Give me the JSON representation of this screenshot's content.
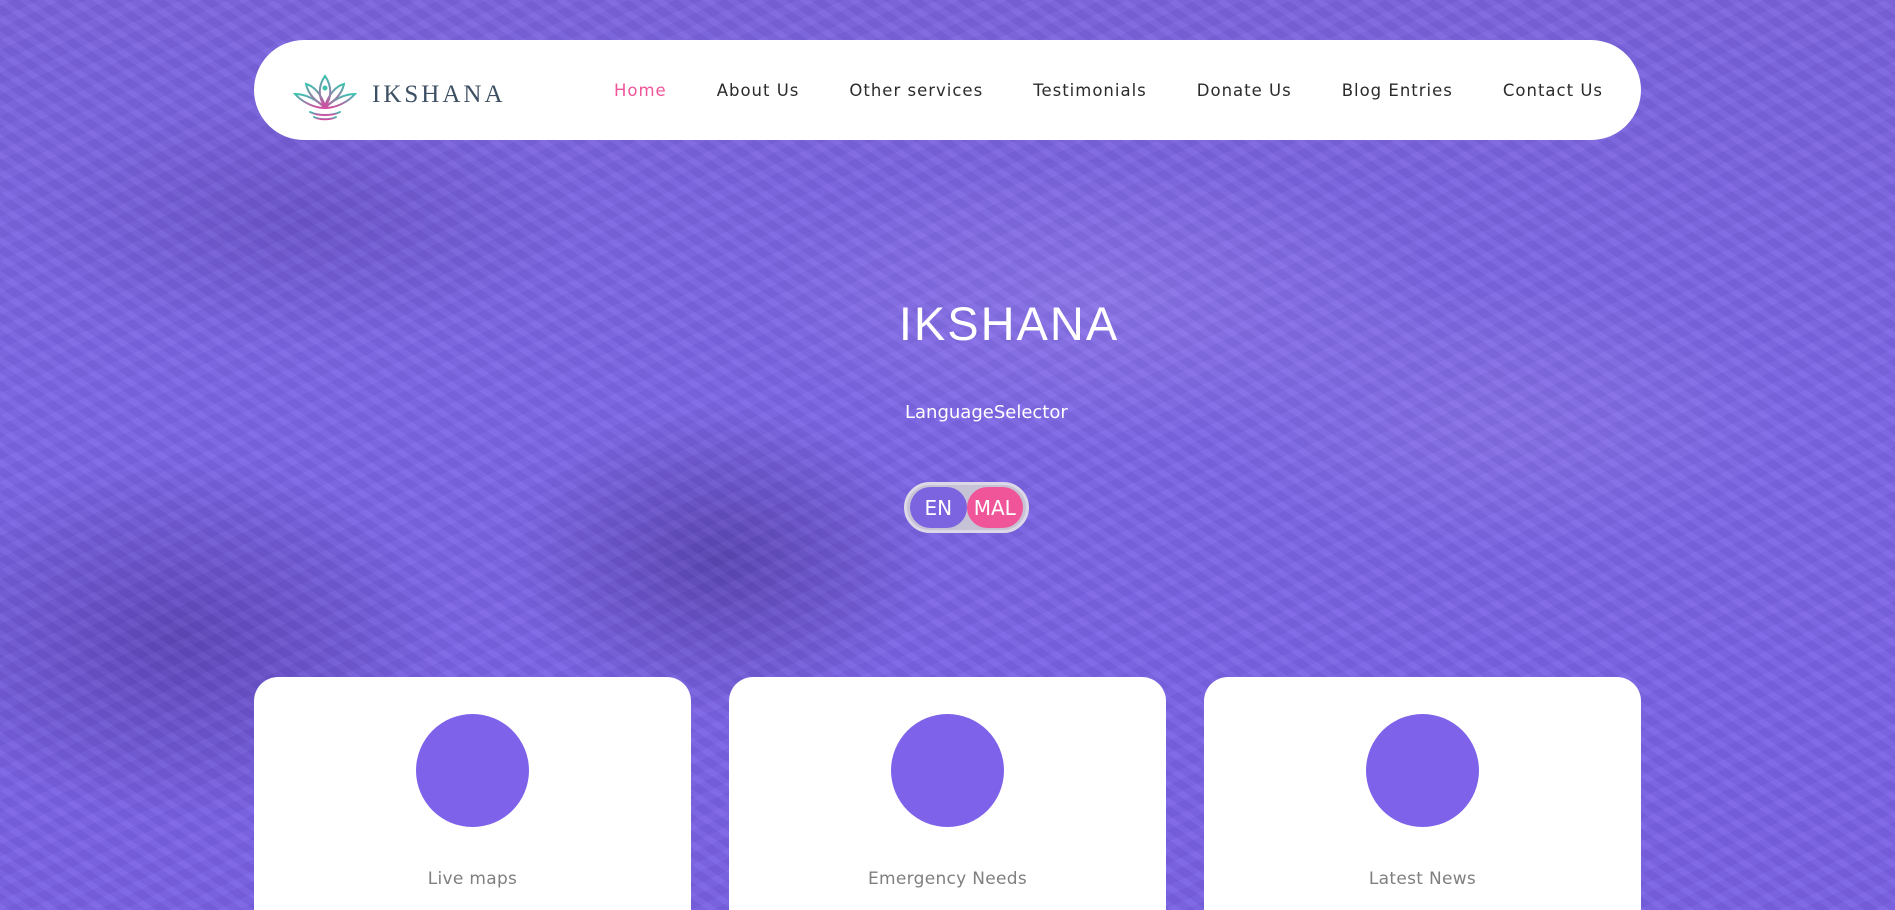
{
  "header": {
    "brand_name": "IKSHANA",
    "nav": [
      {
        "label": "Home",
        "active": true
      },
      {
        "label": "About Us"
      },
      {
        "label": "Other services"
      },
      {
        "label": "Testimonials"
      },
      {
        "label": "Donate Us"
      },
      {
        "label": "Blog Entries"
      },
      {
        "label": "Contact Us"
      }
    ]
  },
  "hero": {
    "title": "IKSHANA",
    "language_label": "LanguageSelector",
    "language_options": [
      "EN",
      "MAL"
    ],
    "selected_language": "MAL"
  },
  "cards": [
    {
      "title": "Live maps"
    },
    {
      "title": "Emergency Needs"
    },
    {
      "title": "Latest News"
    }
  ],
  "colors": {
    "accent": "#f0559a",
    "primary": "#7f62ea",
    "overlay": "#7b63de"
  },
  "icons": {
    "brand_logo": "lotus-logo-icon"
  }
}
